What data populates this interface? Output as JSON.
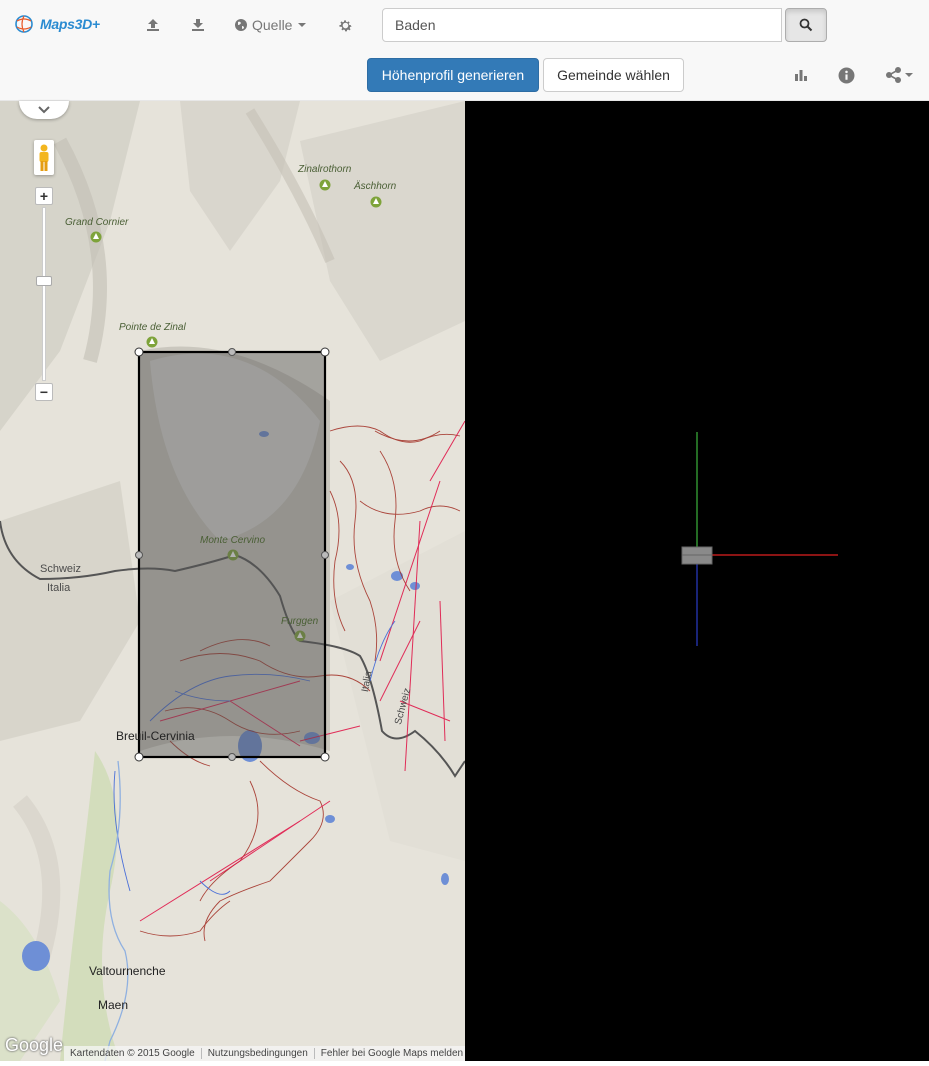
{
  "header": {
    "brand": "Maps3D+",
    "upload_icon": "upload-icon",
    "download_icon": "download-icon",
    "source_label": "Quelle",
    "settings_icon": "gear-icon",
    "search": {
      "value": "Baden",
      "placeholder": "Baden"
    },
    "search_icon": "search-icon",
    "generate_label": "Höhenprofil generieren",
    "municipality_label": "Gemeinde wählen",
    "chart_icon": "bar-chart-icon",
    "info_icon": "info-icon",
    "share_icon": "share-icon"
  },
  "map": {
    "labels": {
      "zinalrothorn": "Zinalrothorn",
      "aschhorn": "Äschhorn",
      "grand_cornier": "Grand Cornier",
      "pointe_de_zinal": "Pointe de Zinal",
      "monte_cervino": "Monte Cervino",
      "furggen": "Furggen",
      "schweiz_left": "Schweiz",
      "italia_left": "Italia",
      "italia_right": "Italia",
      "schweiz_right": "Schweiz",
      "breuil_cervinia": "Breuil-Cervinia",
      "valtournenche": "Valtournenche",
      "maen": "Maen"
    },
    "attribution": {
      "google": "Google",
      "data": "Kartendaten © 2015 Google",
      "terms": "Nutzungsbedingungen",
      "report": "Fehler bei Google Maps melden"
    },
    "colors": {
      "selection_fill": "#555555",
      "ski_run": "#a0291f",
      "lift": "#e0194a",
      "border": "#555555",
      "water": "#6e8fd6"
    }
  },
  "view3d": {
    "axis_colors": {
      "x": "#e02020",
      "y": "#3cb43c",
      "z": "#2a3cc8"
    }
  }
}
